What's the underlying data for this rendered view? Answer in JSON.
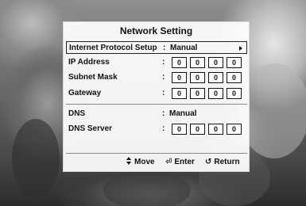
{
  "dialog": {
    "title": "Network Setting",
    "rows": [
      {
        "label": "Internet Protocol Setup",
        "colon": ":",
        "value": "Manual"
      },
      {
        "label": "IP Address",
        "colon": ":",
        "octets": [
          "0",
          "0",
          "0",
          "0"
        ]
      },
      {
        "label": "Subnet Mask",
        "colon": ":",
        "octets": [
          "0",
          "0",
          "0",
          "0"
        ]
      },
      {
        "label": "Gateway",
        "colon": ":",
        "octets": [
          "0",
          "0",
          "0",
          "0"
        ]
      },
      {
        "label": "DNS",
        "colon": ":",
        "value": "Manual"
      },
      {
        "label": "DNS Server",
        "colon": ":",
        "octets": [
          "0",
          "0",
          "0",
          "0"
        ]
      }
    ]
  },
  "footer": {
    "move": {
      "icon": "up-down-arrows-icon",
      "label": "Move"
    },
    "enter": {
      "icon": "enter-icon",
      "glyph": "⏎",
      "label": "Enter"
    },
    "return": {
      "icon": "return-icon",
      "glyph": "↺",
      "label": "Return"
    }
  }
}
